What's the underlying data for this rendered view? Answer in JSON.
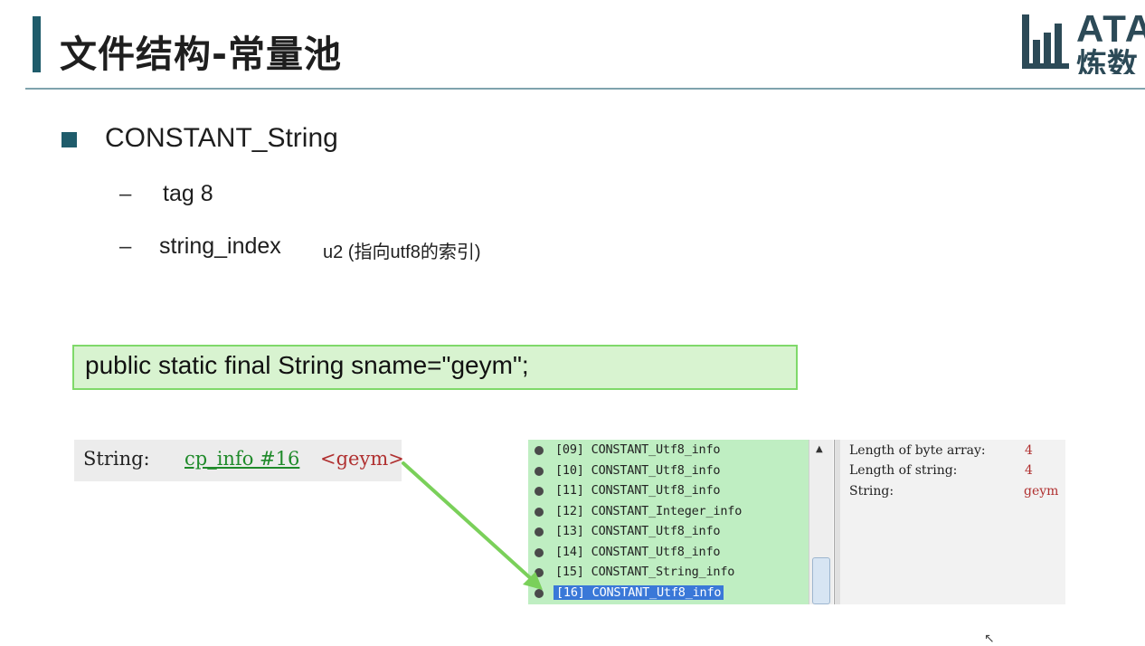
{
  "slide": {
    "title": "文件结构-常量池",
    "logo_top": "ATA",
    "logo_bottom": "炼数"
  },
  "bullets": {
    "main": "CONSTANT_String",
    "dash": "–",
    "sub1": "tag 8",
    "sub2_name": "string_index",
    "sub2_desc": "u2 (指向utf8的索引)"
  },
  "code": {
    "line": "public static final String sname=\"geym\";"
  },
  "string_panel": {
    "label": "String:",
    "link": "cp_info #16",
    "value": "<geym>"
  },
  "constant_list": [
    {
      "text": "[09] CONSTANT_Utf8_info",
      "selected": false
    },
    {
      "text": "[10] CONSTANT_Utf8_info",
      "selected": false
    },
    {
      "text": "[11] CONSTANT_Utf8_info",
      "selected": false
    },
    {
      "text": "[12] CONSTANT_Integer_info",
      "selected": false
    },
    {
      "text": "[13] CONSTANT_Utf8_info",
      "selected": false
    },
    {
      "text": "[14] CONSTANT_Utf8_info",
      "selected": false
    },
    {
      "text": "[15] CONSTANT_String_info",
      "selected": false
    },
    {
      "text": "[16] CONSTANT_Utf8_info",
      "selected": true
    }
  ],
  "info_panel": {
    "rows": [
      {
        "key": "Length of byte array:",
        "value": "4"
      },
      {
        "key": "Length of string:",
        "value": "4"
      },
      {
        "key": "String:",
        "value": "geym"
      }
    ]
  },
  "colors": {
    "accent": "#1f5c6b",
    "code_bg": "#d8f3d0",
    "code_border": "#7fd96a",
    "list_bg": "#bfeec2",
    "selection": "#3a78d8",
    "arrow": "#7ad05a",
    "value_red": "#b03030"
  },
  "icons": {
    "logo": "bar-chart-logo-icon",
    "scroll_up": "triangle-up-icon",
    "list_bullet": "filled-circle-icon"
  }
}
